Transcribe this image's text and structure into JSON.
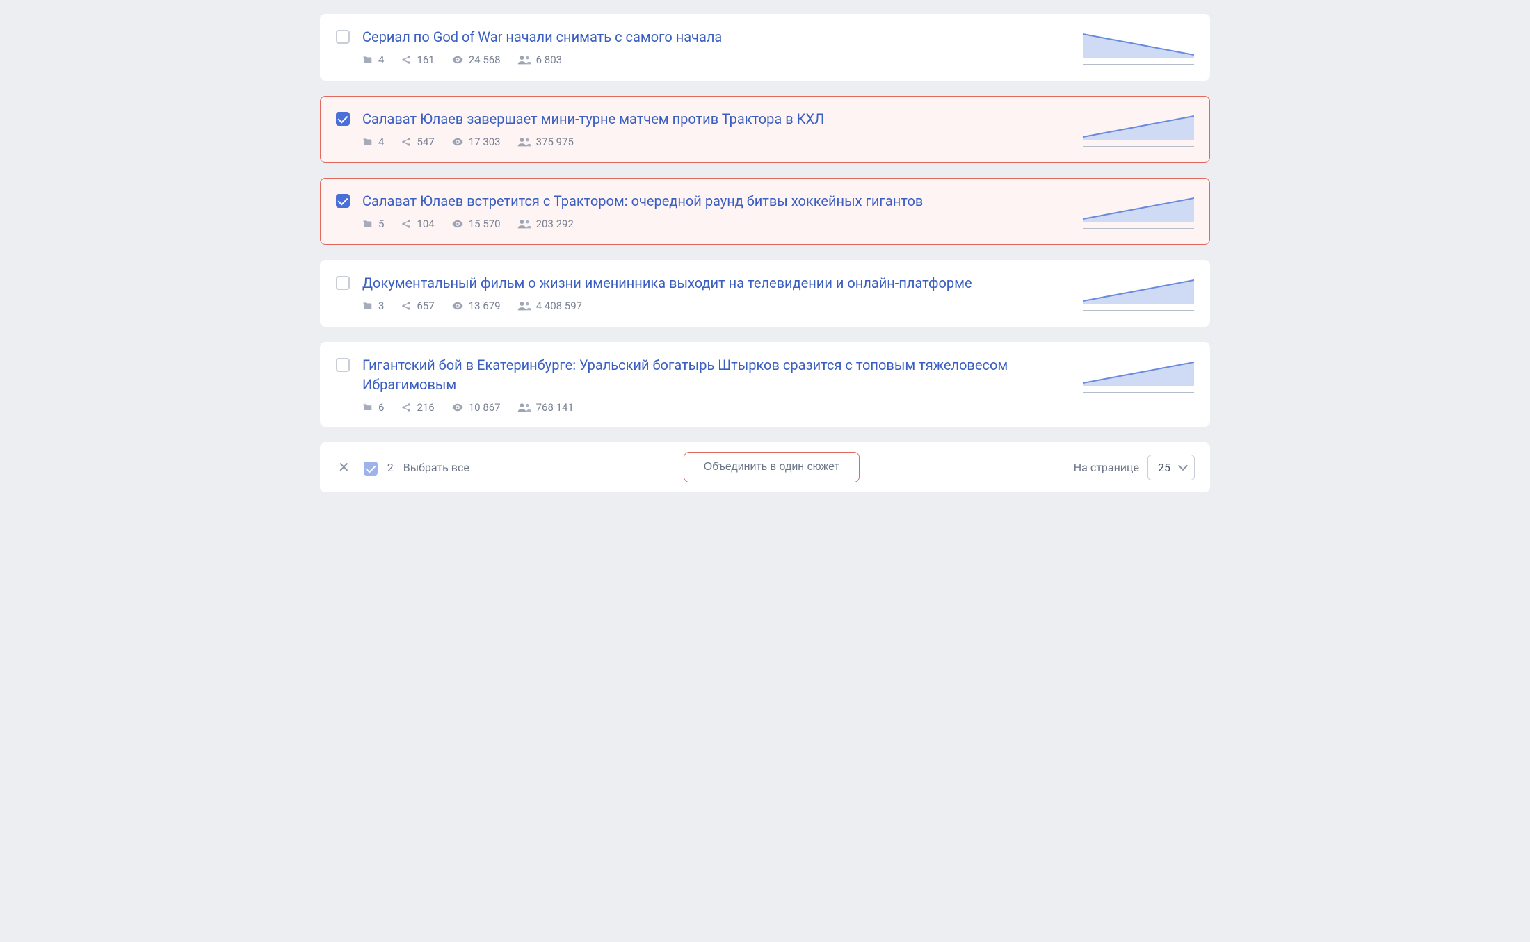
{
  "items": [
    {
      "selected": false,
      "title": "Сериал по God of War начали снимать с самого начала",
      "folders": "4",
      "shares": "161",
      "views": "24 568",
      "audience": "6 803",
      "trend": "down"
    },
    {
      "selected": true,
      "title": "Салават Юлаев завершает мини-турне матчем против Трактора в КХЛ",
      "folders": "4",
      "shares": "547",
      "views": "17 303",
      "audience": "375 975",
      "trend": "up"
    },
    {
      "selected": true,
      "title": "Салават Юлаев встретится с Трактором: очередной раунд битвы хоккейных гигантов",
      "folders": "5",
      "shares": "104",
      "views": "15 570",
      "audience": "203 292",
      "trend": "up"
    },
    {
      "selected": false,
      "title": "Документальный фильм о жизни именинника выходит на телевидении и онлайн-платформе",
      "folders": "3",
      "shares": "657",
      "views": "13 679",
      "audience": "4 408 597",
      "trend": "up"
    },
    {
      "selected": false,
      "title": "Гигантский бой в Екатеринбурге: Уральский богатырь Штырков сразится с топовым тяжеловесом Ибрагимовым",
      "folders": "6",
      "shares": "216",
      "views": "10 867",
      "audience": "768 141",
      "trend": "up"
    }
  ],
  "footer": {
    "selected_count": "2",
    "select_all_label": "Выбрать все",
    "merge_label": "Объединить в один сюжет",
    "per_page_label": "На странице",
    "per_page_value": "25"
  }
}
